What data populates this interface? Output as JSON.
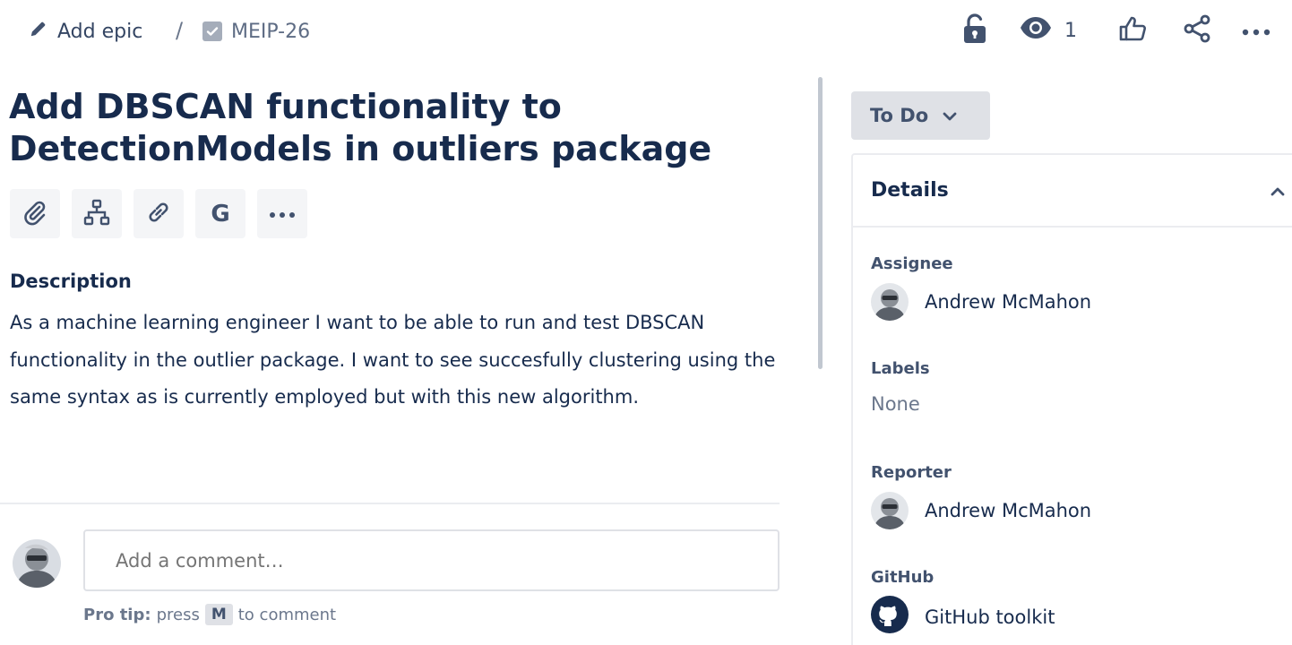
{
  "breadcrumb": {
    "add_epic_label": "Add epic",
    "separator": "/",
    "issue_key": "MEIP-26"
  },
  "top_actions": {
    "watchers_count": "1"
  },
  "issue": {
    "title": "Add DBSCAN functionality to DetectionModels in outliers package",
    "toolbar": {
      "google_label": "G",
      "more_label": "..."
    },
    "description_heading": "Description",
    "description_text": "As a machine learning engineer I want to be able to run and test DBSCAN functionality in the outlier package. I want to see succesfully clustering using the same syntax as is currently employed but with this new algorithm."
  },
  "comment": {
    "placeholder": "Add a comment…",
    "pro_tip_label": "Pro tip:",
    "pro_tip_press": "press",
    "pro_tip_key": "M",
    "pro_tip_suffix": "to comment"
  },
  "status": {
    "label": "To Do"
  },
  "details": {
    "heading": "Details",
    "assignee_label": "Assignee",
    "assignee_name": "Andrew McMahon",
    "labels_label": "Labels",
    "labels_value": "None",
    "reporter_label": "Reporter",
    "reporter_name": "Andrew McMahon",
    "github_label": "GitHub",
    "github_value": "GitHub toolkit"
  },
  "colors": {
    "text_primary": "#172b4d",
    "text_secondary": "#42526e",
    "button_bg": "#f4f5f7",
    "status_bg": "#dfe1e6",
    "border": "#ebecf0"
  }
}
